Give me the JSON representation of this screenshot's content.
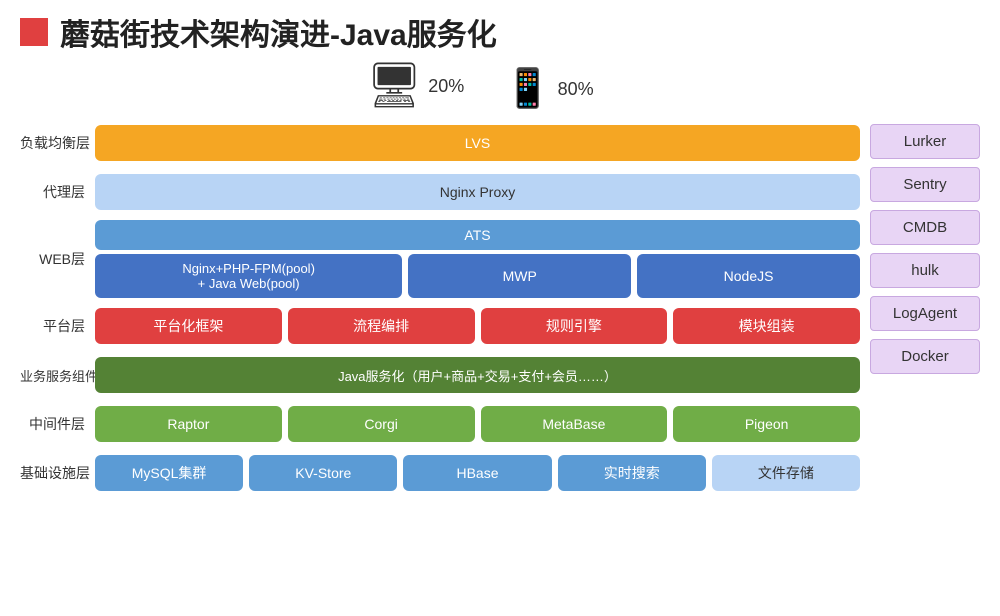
{
  "title": "蘑菇街技术架构演进-Java服务化",
  "icons": {
    "monitor_label": "20%",
    "phone_label": "80%"
  },
  "rows": [
    {
      "label": "负载均衡层",
      "items": [
        {
          "text": "LVS",
          "style": "box-orange box-full",
          "flex": "1"
        }
      ]
    },
    {
      "label": "代理层",
      "items": [
        {
          "text": "Nginx Proxy",
          "style": "box-blue-light box-full",
          "flex": "1"
        }
      ]
    },
    {
      "label": "WEB层",
      "type": "web"
    },
    {
      "label": "平台层",
      "items": [
        {
          "text": "平台化框架",
          "style": "box-red",
          "flex": "1"
        },
        {
          "text": "流程编排",
          "style": "box-red",
          "flex": "1"
        },
        {
          "text": "规则引擎",
          "style": "box-red",
          "flex": "1"
        },
        {
          "text": "模块组装",
          "style": "box-red",
          "flex": "1"
        }
      ]
    },
    {
      "label": "业务服务组件层",
      "items": [
        {
          "text": "Java服务化（用户+商品+交易+支付+会员……）",
          "style": "box-green-dark box-full",
          "flex": "1"
        }
      ]
    },
    {
      "label": "中间件层",
      "items": [
        {
          "text": "Raptor",
          "style": "box-green-medium",
          "flex": "1"
        },
        {
          "text": "Corgi",
          "style": "box-green-medium",
          "flex": "1"
        },
        {
          "text": "MetaBase",
          "style": "box-green-medium",
          "flex": "1"
        },
        {
          "text": "Pigeon",
          "style": "box-green-medium",
          "flex": "1"
        }
      ]
    },
    {
      "label": "基础设施层",
      "items": [
        {
          "text": "MySQL集群",
          "style": "box-blue-medium",
          "flex": "1"
        },
        {
          "text": "KV-Store",
          "style": "box-blue-medium",
          "flex": "1"
        },
        {
          "text": "HBase",
          "style": "box-blue-medium",
          "flex": "1"
        },
        {
          "text": "实时搜索",
          "style": "box-blue-medium",
          "flex": "1"
        },
        {
          "text": "文件存储",
          "style": "box-file",
          "flex": "1"
        }
      ]
    }
  ],
  "web": {
    "ats": "ATS",
    "nginx": "Nginx+PHP-FPM(pool)\n + Java Web(pool)",
    "mwp": "MWP",
    "nodejs": "NodeJS"
  },
  "sidebar": {
    "items": [
      "Lurker",
      "Sentry",
      "CMDB",
      "hulk",
      "LogAgent",
      "Docker"
    ]
  }
}
